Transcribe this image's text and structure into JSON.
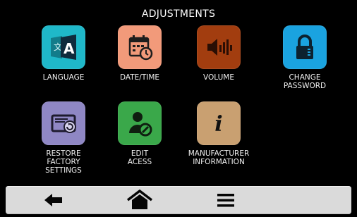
{
  "header": {
    "title": "ADJUSTMENTS"
  },
  "tiles": [
    {
      "label": "LANGUAGE",
      "icon": "language-icon",
      "color": "#1fb8c9"
    },
    {
      "label": "DATE/TIME",
      "icon": "calendar-clock-icon",
      "color": "#f29a7a"
    },
    {
      "label": "VOLUME",
      "icon": "speaker-volume-icon",
      "color": "#a23d0f"
    },
    {
      "label": "CHANGE\nPASSWORD",
      "icon": "padlock-icon",
      "color": "#1aa3e0"
    },
    {
      "label": "RESTORE\nFACTORY\nSETTINGS",
      "icon": "restore-icon",
      "color": "#8f87c4"
    },
    {
      "label": "EDIT\nACESS",
      "icon": "user-edit-icon",
      "color": "#3aa84a"
    },
    {
      "label": "MANUFACTURER\nINFORMATION",
      "icon": "info-icon",
      "color": "#c9a071"
    }
  ],
  "navbar": {
    "items": [
      {
        "name": "back",
        "icon": "arrow-left-icon"
      },
      {
        "name": "home",
        "icon": "home-icon"
      },
      {
        "name": "menu",
        "icon": "hamburger-menu-icon"
      }
    ]
  }
}
